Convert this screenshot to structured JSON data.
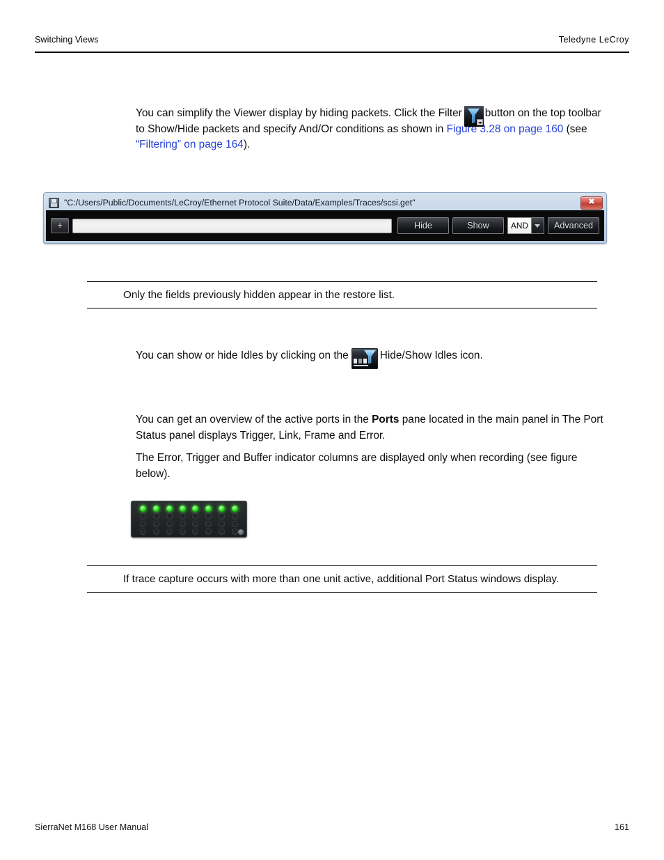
{
  "header": {
    "left": "Switching Views",
    "right": "Teledyne LeCroy"
  },
  "paragraphs": {
    "filter_intro_part1": "You can simplify the Viewer display by hiding packets. Click the Filter",
    "filter_intro_part2": "button on the top toolbar to Show/Hide packets and specify And/Or conditions as shown in",
    "link_figure": "Figure 3.28 on page 160",
    "see_text": "(see",
    "link_filtering": "“Filtering” on page 164",
    "close_paren": ").",
    "idles_part1": "You can show or hide Idles by clicking on the",
    "idles_part2": "Hide/Show Idles icon.",
    "ports_part1": "You can get an overview of the active ports in the",
    "ports_bold": "Ports",
    "ports_part2": "pane located in the main panel in The Port Status panel displays Trigger, Link, Frame and Error.",
    "error_columns": "The Error, Trigger and Buffer indicator columns are displayed only when recording (see figure below)."
  },
  "notes": {
    "note1": "Only the fields previously hidden appear in the restore list.",
    "note2": "If trace capture occurs with more than one unit active, additional Port Status windows display."
  },
  "filter_dialog": {
    "title": "\"C:/Users/Public/Documents/LeCroy/Ethernet Protocol Suite/Data/Examples/Traces/scsi.get\"",
    "close_label": "✖",
    "add_button": "+",
    "input_value": "",
    "input_placeholder": "",
    "hide_button": "Hide",
    "show_button": "Show",
    "logic_value": "AND",
    "advanced_button": "Advanced"
  },
  "port_status": {
    "columns": 8,
    "rows": 4,
    "led_states": [
      [
        "on",
        "on",
        "on",
        "on",
        "on",
        "on",
        "on",
        "on"
      ],
      [
        "off",
        "off",
        "off",
        "off",
        "off",
        "off",
        "off",
        "off"
      ],
      [
        "off",
        "off",
        "off",
        "off",
        "off",
        "off",
        "off",
        "off"
      ],
      [
        "off",
        "off",
        "off",
        "off",
        "off",
        "off",
        "off",
        "off"
      ]
    ],
    "on_color": "#3ce42f",
    "off_color": "#24282b"
  },
  "icons": {
    "filter_icon": "filter-funnel-icon",
    "idles_icon": "hide-show-idles-icon",
    "dialog_icon": "save-floppy-icon"
  },
  "footer": {
    "left": "SierraNet M168 User Manual",
    "page_number": "161"
  },
  "colors": {
    "link": "#2540d8",
    "text": "#0d0d0d",
    "dialog_chrome": "#c3d5e8",
    "toolbar_bg": "#0a0a0a"
  }
}
